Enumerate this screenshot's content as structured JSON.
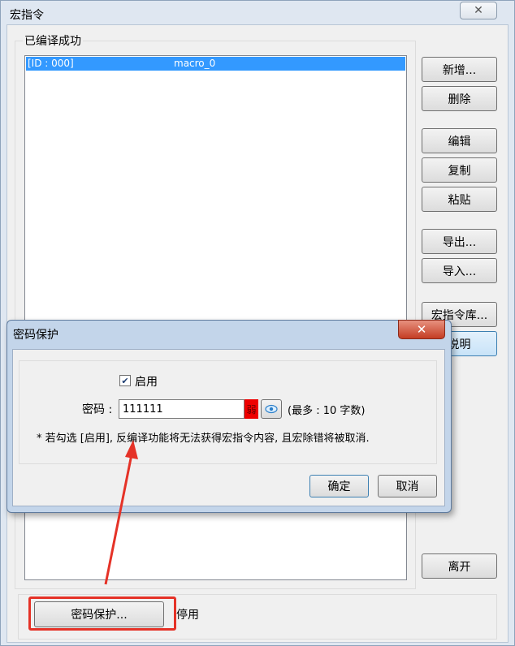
{
  "window": {
    "title": "宏指令"
  },
  "group": {
    "label": "已编译成功"
  },
  "list": {
    "rows": [
      {
        "id": "[ID : 000]",
        "name": "macro_0"
      }
    ]
  },
  "side_buttons": {
    "add": "新增...",
    "delete": "删除",
    "edit": "编辑",
    "copy": "复制",
    "paste": "粘贴",
    "export": "导出...",
    "import": "导入...",
    "library": "宏指令库...",
    "help": "说明",
    "leave": "离开"
  },
  "bottom": {
    "password_button": "密码保护...",
    "status": "停用"
  },
  "dialog": {
    "title": "密码保护",
    "enable_label": "启用",
    "enable_checked": true,
    "password_label": "密码 :",
    "password_value": "111111",
    "strength": "弱",
    "hint": "(最多 : 10 字数)",
    "note": "* 若勾选 [启用], 反编译功能将无法获得宏指令内容, 且宏除错将被取消.",
    "ok": "确定",
    "cancel": "取消"
  },
  "colors": {
    "highlight": "#3399ff",
    "annotation": "#e53227",
    "strength_weak": "#ee0000"
  }
}
